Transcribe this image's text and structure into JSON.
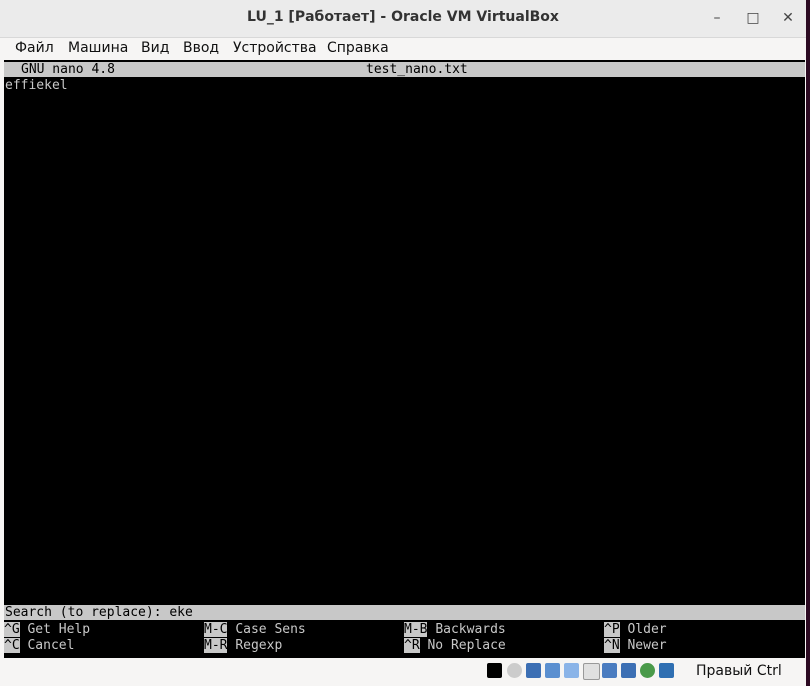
{
  "window": {
    "title": "LU_1 [Работает] - Oracle VM VirtualBox"
  },
  "menu": [
    "Файл",
    "Машина",
    "Вид",
    "Ввод",
    "Устройства",
    "Справка"
  ],
  "nano": {
    "version": "GNU nano 4.8",
    "filename": "test_nano.txt",
    "content": "effiekel",
    "prompt": "Search (to replace): eke",
    "shortcuts": [
      [
        {
          "key": "^G",
          "label": "Get Help"
        },
        {
          "key": "M-C",
          "label": "Case Sens"
        },
        {
          "key": "M-B",
          "label": "Backwards"
        },
        {
          "key": "^P",
          "label": "Older"
        }
      ],
      [
        {
          "key": "^C",
          "label": "Cancel"
        },
        {
          "key": "M-R",
          "label": "Regexp"
        },
        {
          "key": "^R",
          "label": "No Replace"
        },
        {
          "key": "^N",
          "label": "Newer"
        }
      ]
    ]
  },
  "status": {
    "host_key": "Правый Ctrl"
  }
}
